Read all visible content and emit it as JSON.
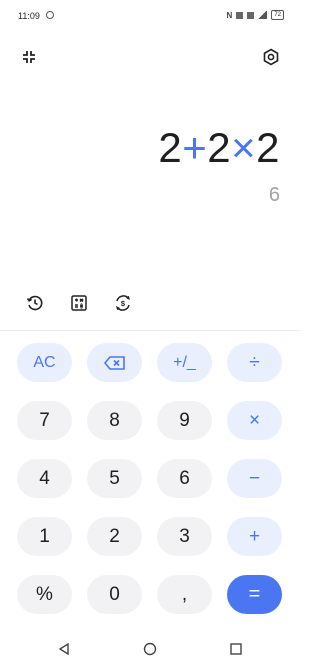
{
  "status_bar": {
    "time": "11:09",
    "battery": "72"
  },
  "display": {
    "expression_parts": [
      "2",
      "+",
      "2",
      "×",
      "2"
    ],
    "result": "6"
  },
  "keypad": {
    "rows": [
      [
        "AC",
        "⌫",
        "+/_",
        "÷"
      ],
      [
        "7",
        "8",
        "9",
        "×"
      ],
      [
        "4",
        "5",
        "6",
        "−"
      ],
      [
        "1",
        "2",
        "3",
        "+"
      ],
      [
        "%",
        "0",
        ",",
        "="
      ]
    ]
  },
  "colors": {
    "accent": "#4a76f2",
    "function_key_bg": "#e9effc",
    "digit_key_bg": "#f2f2f4",
    "result_text": "#a3a3a3"
  },
  "icons": {
    "top_left": "collapse-icon",
    "top_right": "settings-icon",
    "tools": [
      "history-icon",
      "scientific-icon",
      "currency-converter-icon"
    ],
    "nav": [
      "back-icon",
      "home-icon",
      "recents-icon"
    ]
  }
}
